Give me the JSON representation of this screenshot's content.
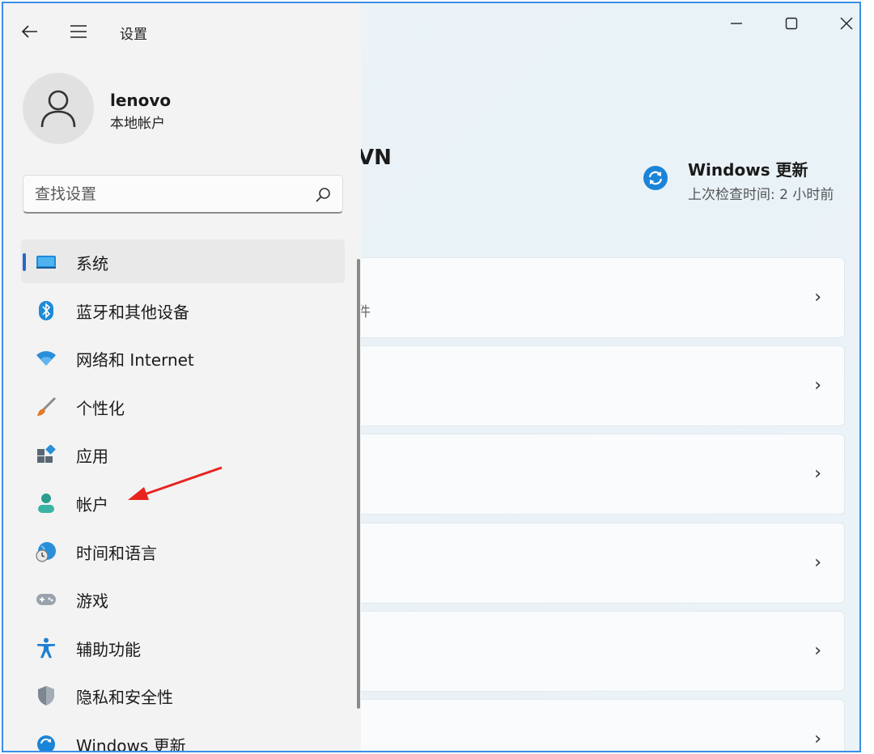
{
  "window": {
    "title": "设置",
    "caption": {
      "minimize": "—",
      "maximize": "☐",
      "close": "✕"
    }
  },
  "user": {
    "name": "lenovo",
    "account_type": "本地帐户"
  },
  "search": {
    "placeholder": "查找设置"
  },
  "nav": {
    "items": [
      {
        "label": "系统",
        "icon": "monitor-icon",
        "active": true
      },
      {
        "label": "蓝牙和其他设备",
        "icon": "bluetooth-icon"
      },
      {
        "label": "网络和 Internet",
        "icon": "wifi-icon"
      },
      {
        "label": "个性化",
        "icon": "brush-icon"
      },
      {
        "label": "应用",
        "icon": "apps-icon"
      },
      {
        "label": "帐户",
        "icon": "account-icon"
      },
      {
        "label": "时间和语言",
        "icon": "globe-clock-icon"
      },
      {
        "label": "游戏",
        "icon": "gamepad-icon"
      },
      {
        "label": "辅助功能",
        "icon": "accessibility-icon"
      },
      {
        "label": "隐私和安全性",
        "icon": "shield-icon"
      },
      {
        "label": "Windows 更新",
        "icon": "update-icon"
      }
    ]
  },
  "main": {
    "title_partial": "VN",
    "update": {
      "title": "Windows 更新",
      "subtitle": "上次检查时间: 2 小时前"
    },
    "cards": [
      {
        "subtitle_partial": "件"
      },
      {
        "subtitle_partial": ""
      },
      {
        "subtitle_partial": ""
      },
      {
        "subtitle_partial": ""
      },
      {
        "subtitle_partial": ""
      },
      {
        "subtitle_partial": ""
      }
    ],
    "chevron": "›"
  },
  "colors": {
    "accent": "#2867c8",
    "annotation_arrow": "#e8231f",
    "window_border": "#3a8ee6"
  }
}
